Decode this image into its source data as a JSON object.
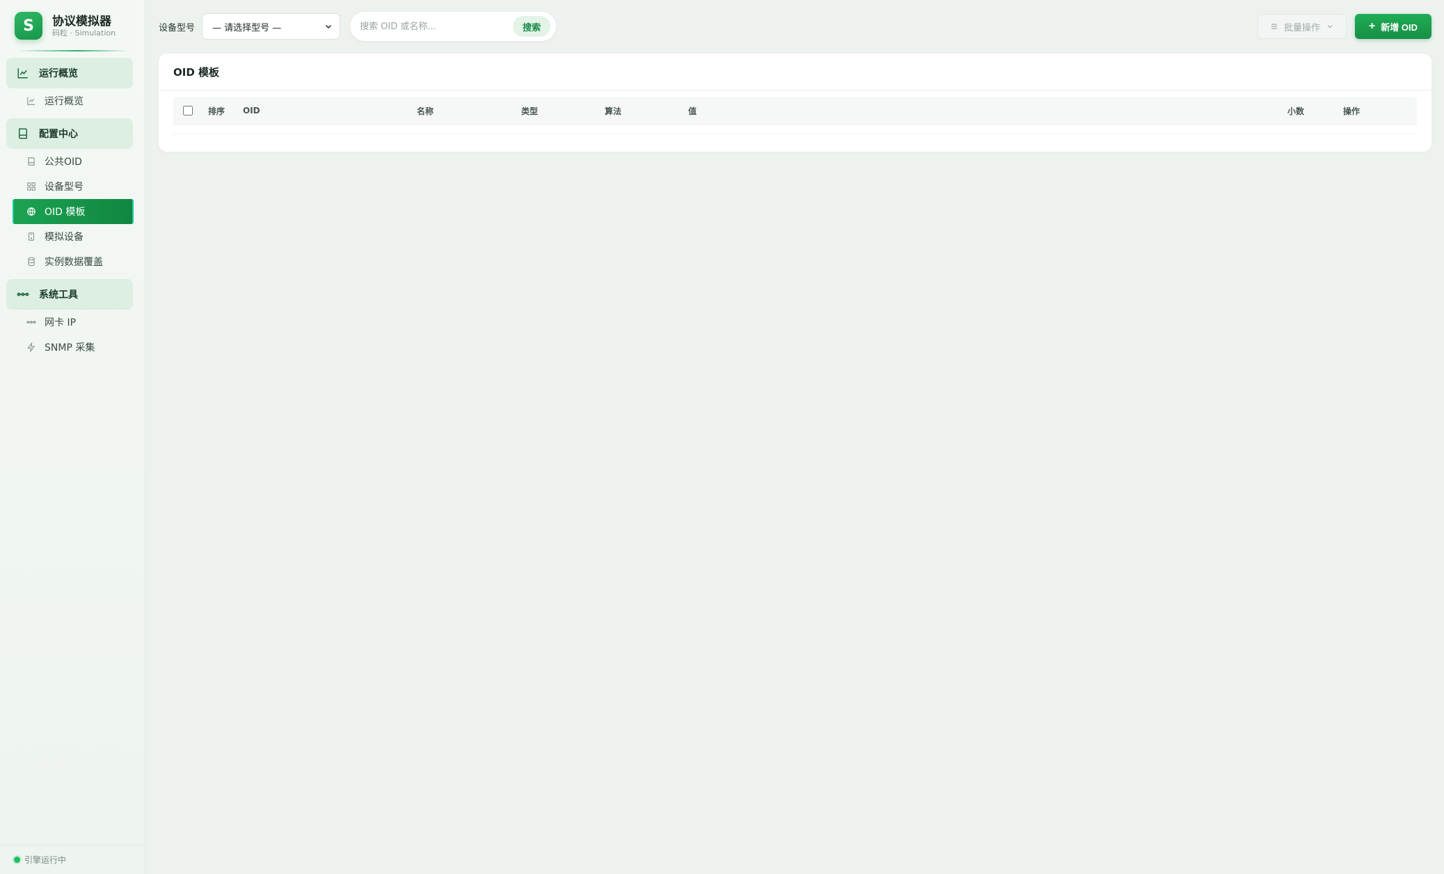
{
  "brand": {
    "logo_letter": "S",
    "title": "协议模拟器",
    "subtitle": "码粒 · Simulation"
  },
  "nav": {
    "groups": [
      {
        "label": "运行概览",
        "icon": "line-chart-icon",
        "items": [
          {
            "label": "运行概览",
            "icon": "line-chart-icon",
            "active": false
          }
        ]
      },
      {
        "label": "配置中心",
        "icon": "book-icon",
        "items": [
          {
            "label": "公共OID",
            "icon": "book-icon",
            "active": false
          },
          {
            "label": "设备型号",
            "icon": "grid-icon",
            "active": false
          },
          {
            "label": "OID 模板",
            "icon": "globe-icon",
            "active": true
          },
          {
            "label": "模拟设备",
            "icon": "device-icon",
            "active": false
          },
          {
            "label": "实例数据覆盖",
            "icon": "database-icon",
            "active": false
          }
        ]
      },
      {
        "label": "系统工具",
        "icon": "network-icon",
        "items": [
          {
            "label": "网卡 IP",
            "icon": "network-icon",
            "active": false
          },
          {
            "label": "SNMP 采集",
            "icon": "bolt-icon",
            "active": false
          }
        ]
      }
    ]
  },
  "footer": {
    "status": "引擎运行中",
    "status_color": "#1fbf60"
  },
  "toolbar": {
    "model_label": "设备型号",
    "model_select_value": "— 请选择型号 —",
    "search_placeholder": "搜索 OID 或名称...",
    "search_button": "搜索",
    "batch_button": "批量操作",
    "add_button": "新增 OID"
  },
  "card": {
    "title": "OID 模板",
    "columns": [
      "排序",
      "OID",
      "名称",
      "类型",
      "算法",
      "值",
      "小数",
      "操作"
    ],
    "rows": []
  },
  "colors": {
    "accent": "#1aa352",
    "background": "#edf2ef"
  }
}
